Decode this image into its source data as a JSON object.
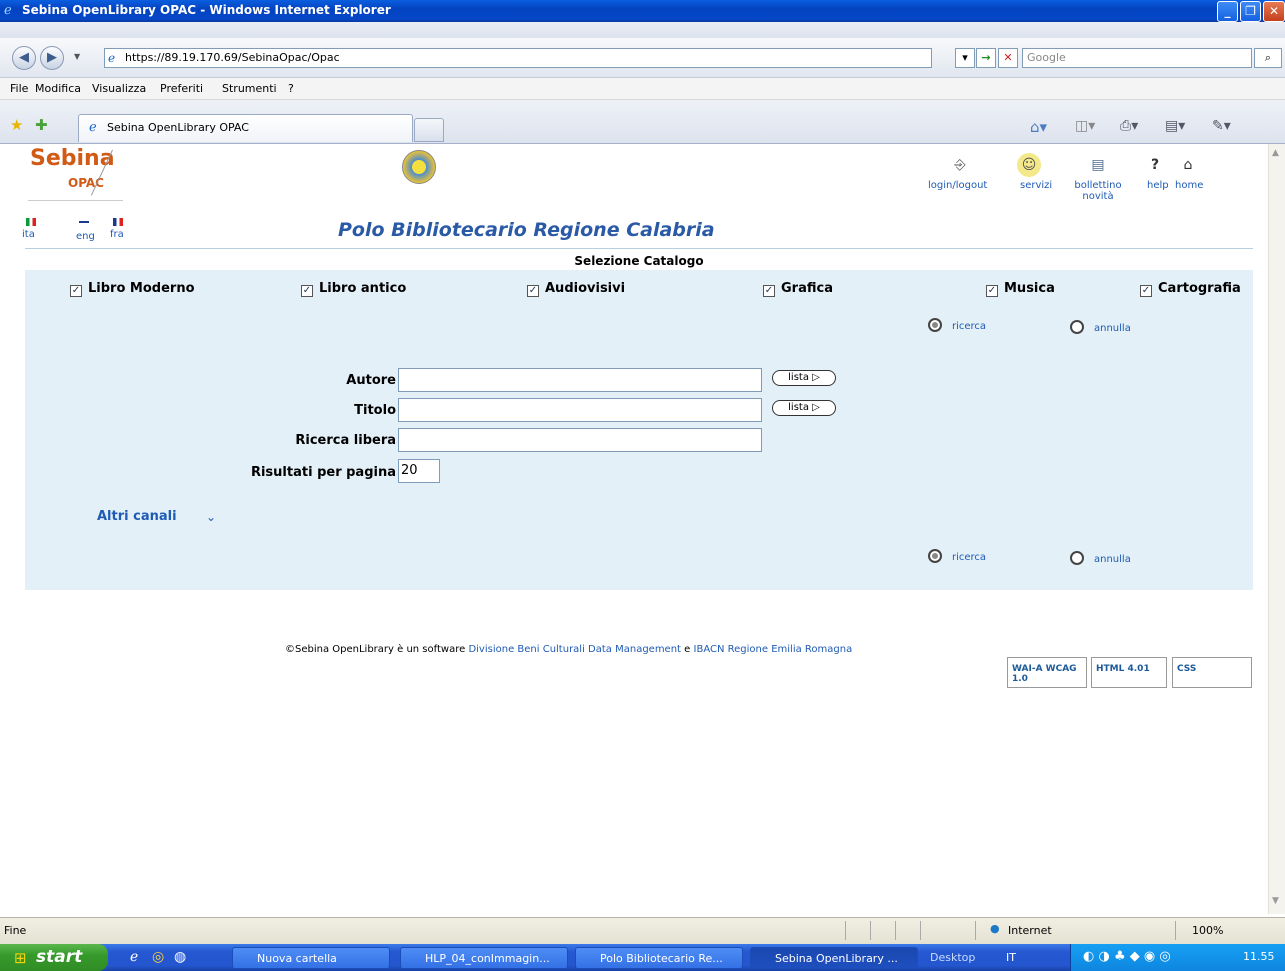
{
  "window": {
    "title": "Sebina OpenLibrary OPAC - Windows Internet Explorer"
  },
  "address": {
    "url": "https://89.19.170.69/SebinaOpac/Opac",
    "search_placeholder": "Google"
  },
  "menu": [
    "File",
    "Modifica",
    "Visualizza",
    "Preferiti",
    "Strumenti",
    "?"
  ],
  "tab": {
    "label": "Sebina OpenLibrary OPAC"
  },
  "site": {
    "logo_top": "Sebina",
    "logo_bottom": "OPAC",
    "languages": [
      "ita",
      "eng",
      "fra"
    ],
    "heading": "Polo Bibliotecario Regione Calabria",
    "top_links": [
      "login/logout",
      "servizi",
      "bollettino novità",
      "help",
      "home"
    ]
  },
  "catalog": {
    "title": "Selezione Catalogo",
    "options": [
      "Libro Moderno",
      "Libro antico",
      "Audiovisivi",
      "Grafica",
      "Musica",
      "Cartografia"
    ]
  },
  "actions": {
    "search": "ricerca",
    "cancel": "annulla"
  },
  "form": {
    "author_label": "Autore",
    "title_label": "Titolo",
    "free_label": "Ricerca libera",
    "results_label": "Risultati per pagina",
    "results_value": "20",
    "list_label": "lista"
  },
  "channels": "Altri canali",
  "footer": {
    "prefix": "©Sebina OpenLibrary è un software",
    "company": "Divisione Beni Culturali Data Management",
    "conj": "e",
    "partner": "IBACN Regione Emilia Romagna",
    "badges": [
      "WAI-A WCAG 1.0",
      "HTML 4.01",
      "CSS"
    ]
  },
  "status": {
    "left": "Fine",
    "zone": "Internet",
    "zoom": "100%"
  },
  "taskbar": {
    "start": "start",
    "tasks": [
      "Nuova cartella",
      "HLP_04_conImmagin...",
      "Polo Bibliotecario Re...",
      "Sebina OpenLibrary ..."
    ],
    "desktop": "Desktop",
    "lang": "IT",
    "clock": "11.55"
  }
}
